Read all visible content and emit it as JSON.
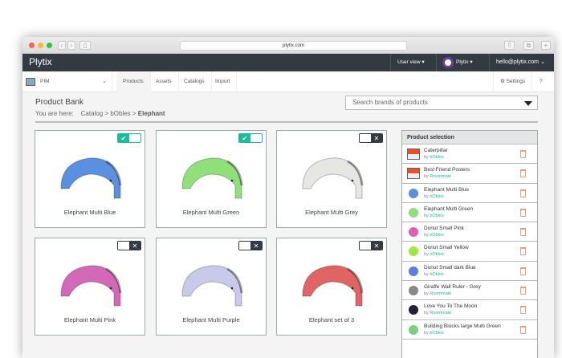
{
  "browser": {
    "url": "plytix.com"
  },
  "nav": {
    "brand": "Plytix",
    "user_view": "User view ▾",
    "account": "Plytix ▾",
    "email": "hello@plytix.com",
    "email_caret": "⌄"
  },
  "subnav": {
    "module": "PIM",
    "tabs": [
      "Products",
      "Assets",
      "Catalogs",
      "Import"
    ],
    "settings": "⚙ Settings",
    "help": "?"
  },
  "page": {
    "title": "Product Bank",
    "breadcrumb_prefix": "You are here:",
    "breadcrumb": "Catalog  >  bObles > ",
    "breadcrumb_current": "Elephant",
    "search_placeholder": "Search brands of products"
  },
  "colors": {
    "accent": "#1abc9c",
    "nav": "#343a42",
    "trash": "#f39c7a"
  },
  "products": [
    {
      "name": "Elephant Multi Blue",
      "selected": true,
      "color": "#5b8fe0"
    },
    {
      "name": "Elephant Multi Green",
      "selected": true,
      "color": "#8fe07a"
    },
    {
      "name": "Elephant Multi Grey",
      "selected": false,
      "color": "#e6e6e2"
    },
    {
      "name": "Elephant Multi Pink",
      "selected": false,
      "color": "#d468b8"
    },
    {
      "name": "Elephant Multi Purple",
      "selected": false,
      "color": "#c9caea"
    },
    {
      "name": "Elephant set of 3",
      "selected": false,
      "color": "#e06464"
    }
  ],
  "selection": {
    "title": "Product selection",
    "by_label": "by",
    "items": [
      {
        "name": "Caterpillar",
        "brand": "bObles",
        "thumb": "poster"
      },
      {
        "name": "Best Friend Posters",
        "brand": "Roommate",
        "thumb": "poster"
      },
      {
        "name": "Elephant Multi Blue",
        "brand": "bObles",
        "thumb": "#5b8fe0"
      },
      {
        "name": "Elephant Multi Green",
        "brand": "bObles",
        "thumb": "#8fe07a"
      },
      {
        "name": "Donut Small Pink",
        "brand": "bObles",
        "thumb": "#e060b0"
      },
      {
        "name": "Donut Small Yellow",
        "brand": "bObles",
        "thumb": "#a0e840"
      },
      {
        "name": "Donut Small dark Blue",
        "brand": "bObles",
        "thumb": "#5b7fe0"
      },
      {
        "name": "Giraffe Wall Ruler - Grey",
        "brand": "Roommate",
        "thumb": "#888"
      },
      {
        "name": "Love You To The Moon",
        "brand": "Roommate",
        "thumb": "#223"
      },
      {
        "name": "Building Blocks large Multi Green",
        "brand": "bObles",
        "thumb": "#7bd080"
      }
    ]
  }
}
